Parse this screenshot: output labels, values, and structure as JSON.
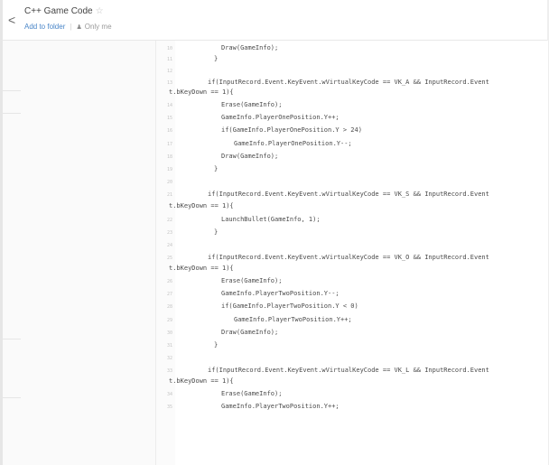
{
  "header": {
    "back_label": "<",
    "title": "C++ Game Code",
    "star": "☆",
    "add_to_folder": "Add to folder",
    "separator": "|",
    "person_icon": "person-icon",
    "visibility": "Only me"
  },
  "code": {
    "lines": [
      {
        "num": "10",
        "text": "Draw(GameInfo);"
      },
      {
        "num": "11",
        "text": "}"
      },
      {
        "num": "12",
        "text": ""
      },
      {
        "num": "13",
        "text": "if(InputRecord.Event.KeyEvent.wVirtualKeyCode == VK_A && InputRecord.Event"
      },
      {
        "num": "",
        "text": "t.bKeyDown == 1){"
      },
      {
        "num": "14",
        "text": "Erase(GameInfo);"
      },
      {
        "num": "15",
        "text": "GameInfo.PlayerOnePosition.Y++;"
      },
      {
        "num": "16",
        "text": "if(GameInfo.PlayerOnePosition.Y > 24)"
      },
      {
        "num": "17",
        "text": "GameInfo.PlayerOnePosition.Y--;"
      },
      {
        "num": "18",
        "text": "Draw(GameInfo);"
      },
      {
        "num": "19",
        "text": "}"
      },
      {
        "num": "20",
        "text": ""
      },
      {
        "num": "21",
        "text": "if(InputRecord.Event.KeyEvent.wVirtualKeyCode == VK_S && InputRecord.Event"
      },
      {
        "num": "",
        "text": "t.bKeyDown == 1){"
      },
      {
        "num": "22",
        "text": "LaunchBullet(GameInfo, 1);"
      },
      {
        "num": "23",
        "text": "}"
      },
      {
        "num": "24",
        "text": ""
      },
      {
        "num": "25",
        "text": "if(InputRecord.Event.KeyEvent.wVirtualKeyCode == VK_O && InputRecord.Event"
      },
      {
        "num": "",
        "text": "t.bKeyDown == 1){"
      },
      {
        "num": "26",
        "text": "Erase(GameInfo);"
      },
      {
        "num": "27",
        "text": "GameInfo.PlayerTwoPosition.Y--;"
      },
      {
        "num": "28",
        "text": "if(GameInfo.PlayerTwoPosition.Y < 0)"
      },
      {
        "num": "29",
        "text": "GameInfo.PlayerTwoPosition.Y++;"
      },
      {
        "num": "30",
        "text": "Draw(GameInfo);"
      },
      {
        "num": "31",
        "text": "}"
      },
      {
        "num": "32",
        "text": ""
      },
      {
        "num": "33",
        "text": "if(InputRecord.Event.KeyEvent.wVirtualKeyCode == VK_L && InputRecord.Event"
      },
      {
        "num": "",
        "text": "t.bKeyDown == 1){"
      },
      {
        "num": "34",
        "text": "Erase(GameInfo);"
      },
      {
        "num": "35",
        "text": "GameInfo.PlayerTwoPosition.Y++;"
      }
    ]
  }
}
